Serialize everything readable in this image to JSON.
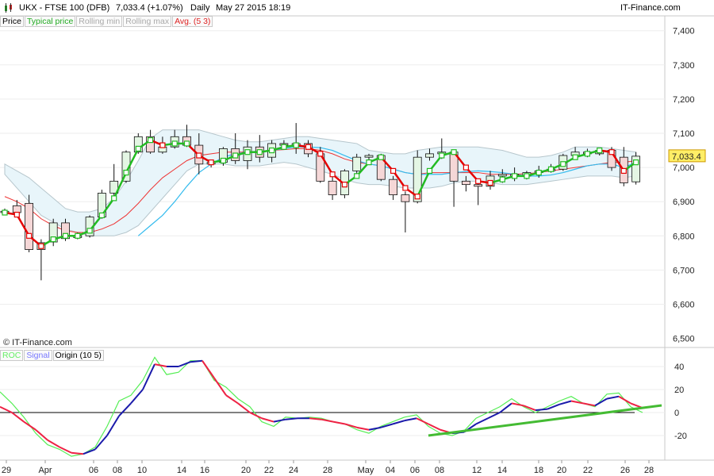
{
  "header": {
    "symbol": "UKX - FTSE 100 (DFB)",
    "last": "7,033.4 (+1.07%)",
    "period": "Daily",
    "datetime": "May 27 2015 18:19",
    "brand": "IT-Finance.com"
  },
  "indicators": {
    "price": "Price",
    "typical": "Typical price",
    "rollmin": "Rolling min",
    "rollmax": "Rolling max",
    "avg": "Avg. (5 3)"
  },
  "lower_legend": {
    "roc": "ROC",
    "signal": "Signal",
    "origin": "Origin (10 5)"
  },
  "copyright": "© IT-Finance.com",
  "last_price_tag": "7,033.4",
  "colors": {
    "up_candle": "#e4f6e4",
    "down_candle": "#f5d7d7",
    "avg_up": "#22bb22",
    "avg_down": "#e40000",
    "band_fill": "#e8f5fa",
    "ma_blue": "#33bbee",
    "ma_red": "#ee3333",
    "roc_green": "#55ee55",
    "signal_blue": "#6666ff",
    "trend_green": "#44bb33",
    "price_tag": "#ffee66"
  },
  "chart_data": [
    {
      "type": "candlestick",
      "title": "UKX - FTSE 100 (DFB)",
      "y_ticks": [
        6600,
        6700,
        6800,
        6900,
        7000,
        7100,
        7200,
        7300,
        7400,
        6500
      ],
      "y_tick_labels": [
        "6,600",
        "6,700",
        "6,800",
        "6,900",
        "7,000",
        "7,100",
        "7,200",
        "7,300",
        "7,400",
        "6,500"
      ],
      "ylim": [
        6485,
        7460
      ],
      "x_labels": [
        "29",
        "Apr",
        "06",
        "08",
        "10",
        "14",
        "16",
        "20",
        "22",
        "24",
        "28",
        "May",
        "04",
        "06",
        "08",
        "12",
        "14",
        "18",
        "20",
        "22",
        "26",
        "28"
      ],
      "candles": [
        {
          "o": 6872,
          "h": 6880,
          "l": 6862,
          "c": 6868
        },
        {
          "o": 6888,
          "h": 6905,
          "l": 6858,
          "c": 6868
        },
        {
          "o": 6895,
          "h": 6920,
          "l": 6752,
          "c": 6760
        },
        {
          "o": 6760,
          "h": 6790,
          "l": 6670,
          "c": 6780
        },
        {
          "o": 6782,
          "h": 6850,
          "l": 6770,
          "c": 6838
        },
        {
          "o": 6838,
          "h": 6850,
          "l": 6785,
          "c": 6792
        },
        {
          "o": 6795,
          "h": 6810,
          "l": 6790,
          "c": 6800
        },
        {
          "o": 6800,
          "h": 6860,
          "l": 6795,
          "c": 6855
        },
        {
          "o": 6855,
          "h": 6935,
          "l": 6850,
          "c": 6925
        },
        {
          "o": 6925,
          "h": 7010,
          "l": 6915,
          "c": 6960
        },
        {
          "o": 6960,
          "h": 7050,
          "l": 6955,
          "c": 7045
        },
        {
          "o": 7045,
          "h": 7100,
          "l": 7040,
          "c": 7090
        },
        {
          "o": 7090,
          "h": 7110,
          "l": 7040,
          "c": 7045
        },
        {
          "o": 7045,
          "h": 7090,
          "l": 7040,
          "c": 7060
        },
        {
          "o": 7060,
          "h": 7110,
          "l": 7055,
          "c": 7090
        },
        {
          "o": 7090,
          "h": 7125,
          "l": 7060,
          "c": 7065
        },
        {
          "o": 7065,
          "h": 7100,
          "l": 6980,
          "c": 7010
        },
        {
          "o": 7010,
          "h": 7020,
          "l": 7000,
          "c": 7015
        },
        {
          "o": 7015,
          "h": 7060,
          "l": 7005,
          "c": 7055
        },
        {
          "o": 7055,
          "h": 7100,
          "l": 7010,
          "c": 7020
        },
        {
          "o": 7020,
          "h": 7080,
          "l": 6995,
          "c": 7060
        },
        {
          "o": 7060,
          "h": 7095,
          "l": 7015,
          "c": 7030
        },
        {
          "o": 7030,
          "h": 7080,
          "l": 7015,
          "c": 7070
        },
        {
          "o": 7070,
          "h": 7080,
          "l": 7060,
          "c": 7065
        },
        {
          "o": 7065,
          "h": 7130,
          "l": 7040,
          "c": 7070
        },
        {
          "o": 7070,
          "h": 7080,
          "l": 7030,
          "c": 7040
        },
        {
          "o": 7040,
          "h": 7060,
          "l": 6955,
          "c": 6960
        },
        {
          "o": 6960,
          "h": 6975,
          "l": 6905,
          "c": 6920
        },
        {
          "o": 6920,
          "h": 6995,
          "l": 6910,
          "c": 6990
        },
        {
          "o": 6990,
          "h": 7040,
          "l": 6980,
          "c": 7030
        },
        {
          "o": 7030,
          "h": 7040,
          "l": 7020,
          "c": 7035
        },
        {
          "o": 7035,
          "h": 7040,
          "l": 6960,
          "c": 6965
        },
        {
          "o": 6965,
          "h": 6975,
          "l": 6905,
          "c": 6920
        },
        {
          "o": 6920,
          "h": 6930,
          "l": 6810,
          "c": 6900
        },
        {
          "o": 6900,
          "h": 7050,
          "l": 6895,
          "c": 7030
        },
        {
          "o": 7030,
          "h": 7055,
          "l": 7020,
          "c": 7040
        },
        {
          "o": 7040,
          "h": 7085,
          "l": 7025,
          "c": 7045
        },
        {
          "o": 7045,
          "h": 7050,
          "l": 6885,
          "c": 6960
        },
        {
          "o": 6960,
          "h": 6975,
          "l": 6930,
          "c": 6950
        },
        {
          "o": 6950,
          "h": 6965,
          "l": 6890,
          "c": 6945
        },
        {
          "o": 6945,
          "h": 6990,
          "l": 6935,
          "c": 6975
        },
        {
          "o": 6975,
          "h": 6995,
          "l": 6955,
          "c": 6980
        },
        {
          "o": 6980,
          "h": 7000,
          "l": 6960,
          "c": 6975
        },
        {
          "o": 6975,
          "h": 6990,
          "l": 6965,
          "c": 6985
        },
        {
          "o": 6985,
          "h": 7005,
          "l": 6970,
          "c": 6990
        },
        {
          "o": 6990,
          "h": 7010,
          "l": 6985,
          "c": 6995
        },
        {
          "o": 6995,
          "h": 7040,
          "l": 6990,
          "c": 7035
        },
        {
          "o": 7035,
          "h": 7060,
          "l": 7025,
          "c": 7045
        },
        {
          "o": 7045,
          "h": 7055,
          "l": 7030,
          "c": 7040
        },
        {
          "o": 7040,
          "h": 7055,
          "l": 7035,
          "c": 7050
        },
        {
          "o": 7050,
          "h": 7060,
          "l": 6990,
          "c": 7000
        },
        {
          "o": 7030,
          "h": 7060,
          "l": 6945,
          "c": 6955
        },
        {
          "o": 6958,
          "h": 7045,
          "l": 6950,
          "c": 7033
        }
      ],
      "avg_5_3": [
        6868,
        6862,
        6800,
        6770,
        6790,
        6800,
        6800,
        6815,
        6860,
        6910,
        6985,
        7055,
        7080,
        7065,
        7070,
        7070,
        7035,
        7015,
        7020,
        7035,
        7045,
        7045,
        7050,
        7060,
        7065,
        7060,
        7040,
        6980,
        6950,
        6975,
        7015,
        7030,
        6990,
        6940,
        6915,
        6990,
        7035,
        7045,
        7000,
        6960,
        6955,
        6965,
        6975,
        6975,
        6985,
        6995,
        7010,
        7030,
        7040,
        7050,
        7045,
        6990,
        7015
      ],
      "ma_slow": [
        6915,
        6900,
        6880,
        6850,
        6830,
        6815,
        6810,
        6810,
        6820,
        6835,
        6860,
        6895,
        6935,
        6970,
        6995,
        7020,
        7035,
        7040,
        7045,
        7045,
        7045,
        7048,
        7050,
        7052,
        7055,
        7055,
        7050,
        7040,
        7025,
        7015,
        7010,
        7005,
        6995,
        6985,
        6980,
        6985,
        6985,
        6985,
        6985,
        6985,
        6980,
        6980,
        6980,
        6982,
        6985,
        6990,
        6995,
        7000,
        7005,
        7010,
        7015,
        7015,
        7020
      ],
      "ma_fast": [
        null,
        null,
        null,
        null,
        null,
        null,
        null,
        null,
        null,
        null,
        null,
        6800,
        6830,
        6860,
        6900,
        6945,
        6985,
        7010,
        7030,
        7040,
        7045,
        7048,
        7050,
        7055,
        7060,
        7060,
        7058,
        7050,
        7035,
        7020,
        7010,
        7005,
        6995,
        6985,
        6980,
        6980,
        6980,
        6985,
        6988,
        6990,
        6988,
        6985,
        6980,
        6975,
        6975,
        6978,
        6985,
        6995,
        7005,
        7010,
        7010,
        7000,
        7015
      ],
      "band_upper": [
        7010,
        6990,
        6970,
        6940,
        6910,
        6880,
        6870,
        6870,
        6880,
        6910,
        6960,
        7020,
        7085,
        7110,
        7110,
        7110,
        7110,
        7100,
        7090,
        7080,
        7075,
        7075,
        7080,
        7085,
        7090,
        7090,
        7085,
        7080,
        7075,
        7070,
        7050,
        7045,
        7040,
        7040,
        7050,
        7055,
        7060,
        7060,
        7060,
        7060,
        7055,
        7050,
        7040,
        7030,
        7030,
        7035,
        7045,
        7060,
        7060,
        7060,
        7055,
        7050,
        7045
      ],
      "band_lower": [
        6980,
        6940,
        6900,
        6860,
        6840,
        6820,
        6810,
        6800,
        6800,
        6800,
        6810,
        6830,
        6870,
        6910,
        6950,
        6990,
        7010,
        7010,
        7010,
        7005,
        7005,
        7005,
        7010,
        7015,
        7010,
        7000,
        6990,
        6980,
        6965,
        6955,
        6950,
        6950,
        6945,
        6940,
        6940,
        6940,
        6945,
        6955,
        6960,
        6960,
        6955,
        6950,
        6950,
        6950,
        6955,
        6960,
        6965,
        6970,
        6975,
        6975,
        6975,
        6970,
        6975
      ]
    },
    {
      "type": "line",
      "title": "",
      "y_ticks": [
        40,
        20,
        0,
        -20
      ],
      "y_tick_labels": [
        "40",
        "20",
        "0",
        "-20"
      ],
      "ylim": [
        -42,
        52
      ],
      "series": [
        {
          "name": "ROC",
          "values": [
            18,
            8,
            -4,
            -18,
            -28,
            -32,
            -38,
            -36,
            -30,
            -12,
            10,
            15,
            28,
            48,
            33,
            35,
            45,
            45,
            28,
            22,
            12,
            5,
            -8,
            -12,
            -4,
            -5,
            -4,
            -5,
            -8,
            -10,
            -15,
            -18,
            -12,
            -8,
            -4,
            -2,
            -12,
            -18,
            -20,
            -16,
            -5,
            0,
            5,
            12,
            5,
            0,
            5,
            10,
            14,
            8,
            5,
            16,
            17,
            5,
            0
          ]
        },
        {
          "name": "Signal",
          "values": [
            5,
            0,
            -8,
            -15,
            -24,
            -30,
            -35,
            -36,
            -32,
            -20,
            -3,
            8,
            20,
            42,
            40,
            40,
            44,
            45,
            30,
            15,
            8,
            0,
            -5,
            -8,
            -6,
            -5,
            -5,
            -6,
            -8,
            -10,
            -13,
            -15,
            -13,
            -10,
            -7,
            -5,
            -10,
            -15,
            -18,
            -17,
            -10,
            -5,
            0,
            8,
            6,
            2,
            3,
            7,
            10,
            8,
            6,
            12,
            14,
            8,
            4
          ]
        },
        {
          "name": "Origin",
          "values": [
            0,
            0,
            0,
            0,
            0,
            0,
            0,
            0,
            0,
            0,
            0,
            0,
            0,
            0,
            0,
            0,
            0,
            0,
            0,
            0,
            0,
            0,
            0,
            0,
            0,
            0,
            0,
            0,
            0,
            0,
            0,
            0,
            0,
            0,
            0,
            0,
            0,
            0,
            0,
            0,
            0,
            0,
            0,
            0,
            0,
            0,
            0,
            0,
            0,
            0,
            0,
            0,
            0,
            0,
            0
          ]
        }
      ],
      "trendline": {
        "from": [
          36,
          -19
        ],
        "to": [
          58,
          8
        ]
      }
    }
  ]
}
